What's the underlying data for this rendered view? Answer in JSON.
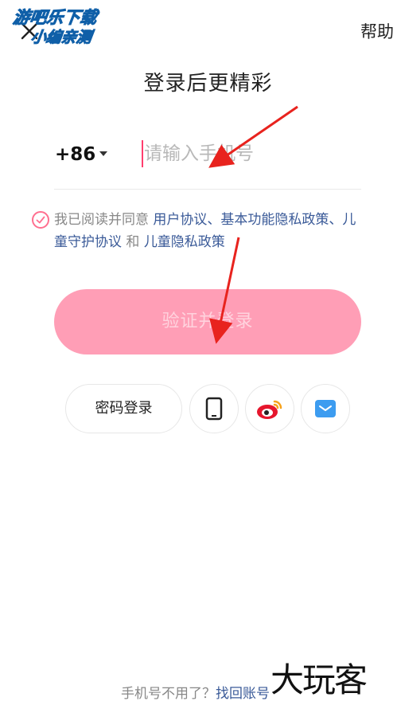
{
  "watermark": {
    "line1": "游吧乐下载",
    "line2": "小编亲测",
    "corner": "大玩客"
  },
  "topbar": {
    "help_label": "帮助"
  },
  "main": {
    "title": "登录后更精彩",
    "country_code": "+86",
    "phone_placeholder": "请输入手机号",
    "phone_value": ""
  },
  "agreement": {
    "prefix": "我已阅读并同意 ",
    "link_user": "用户协议",
    "sep1": "、",
    "link_privacy": "基本功能隐私政策",
    "sep2": "、",
    "link_child": "儿童守护协议",
    "and": " 和 ",
    "link_child_privacy": "儿童隐私政策"
  },
  "login_button": {
    "label": "验证并登录"
  },
  "alt_login": {
    "password_label": "密码登录"
  },
  "bottom": {
    "prefix": "手机号不用了？",
    "link": "找回账号"
  },
  "colors": {
    "accent": "#ff9eb6",
    "link": "#3a5a98",
    "caret": "#ff3d6e",
    "weibo_red": "#e6162d",
    "mail_blue": "#3d9cf0"
  }
}
